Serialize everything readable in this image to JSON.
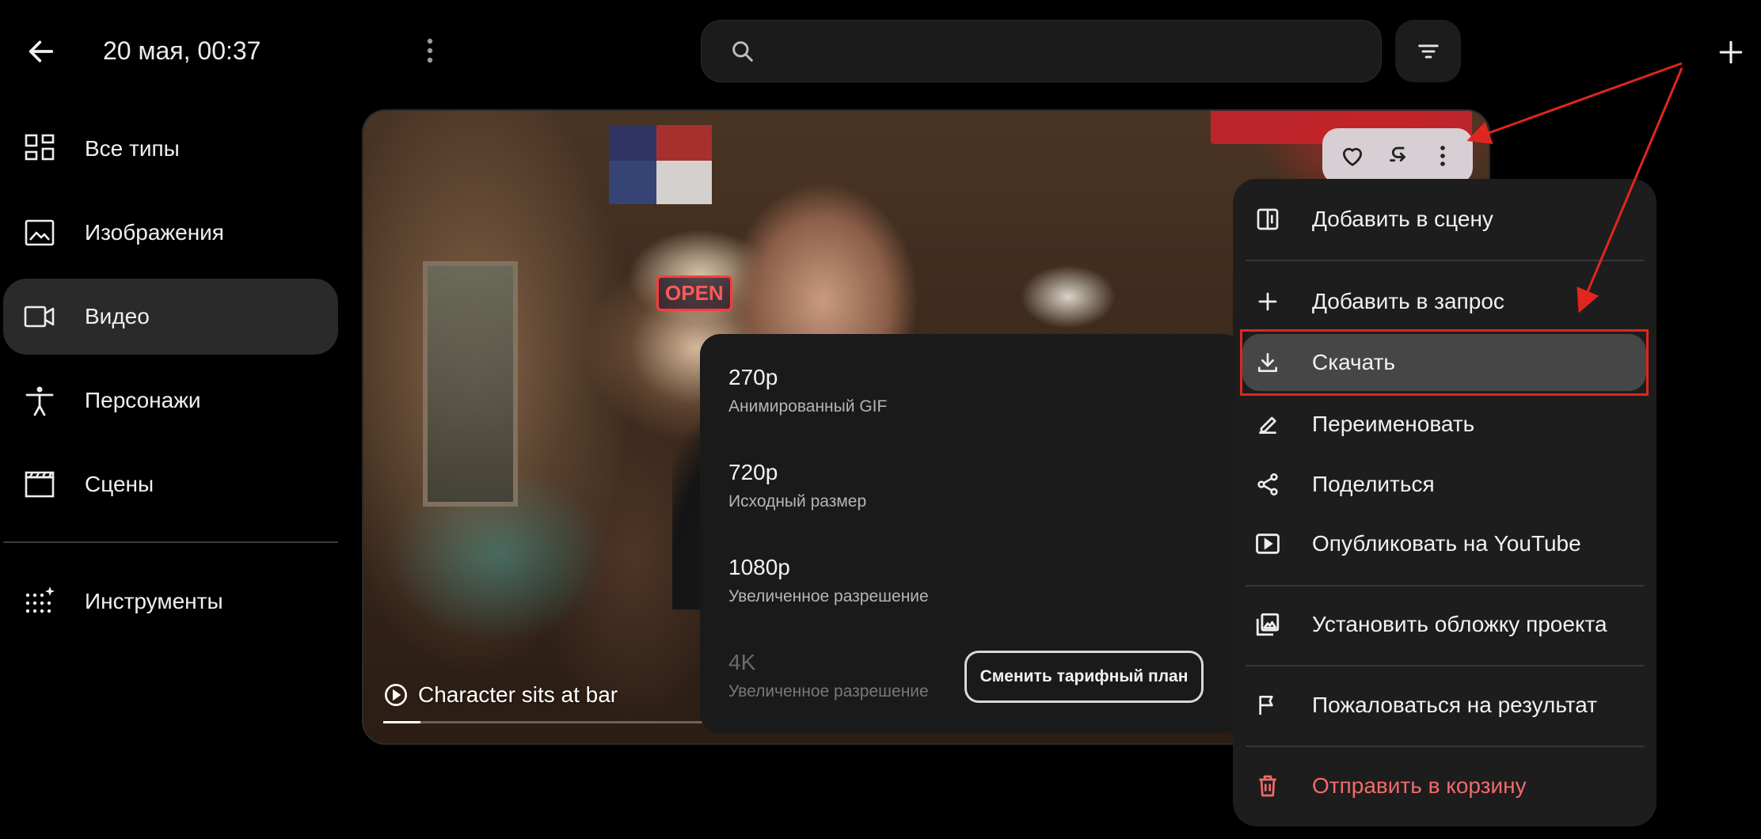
{
  "header": {
    "title": "20 мая, 00:37",
    "search_placeholder": ""
  },
  "sidebar": {
    "items": [
      {
        "label": "Все типы",
        "icon": "grid-icon"
      },
      {
        "label": "Изображения",
        "icon": "image-icon"
      },
      {
        "label": "Видео",
        "icon": "video-camera-icon",
        "active": true
      },
      {
        "label": "Персонажи",
        "icon": "person-icon"
      },
      {
        "label": "Сцены",
        "icon": "clapperboard-icon"
      },
      {
        "label": "Инструменты",
        "icon": "sparkle-dots-icon"
      }
    ]
  },
  "video": {
    "caption": "Character sits at bar",
    "progress": 0.115,
    "poster_sign": "OPEN"
  },
  "download_options": [
    {
      "resolution": "270p",
      "description": "Анимированный GIF",
      "enabled": true
    },
    {
      "resolution": "720p",
      "description": "Исходный размер",
      "enabled": true
    },
    {
      "resolution": "1080p",
      "description": "Увеличенное разрешение",
      "enabled": true
    },
    {
      "resolution": "4K",
      "description": "Увеличенное разрешение",
      "enabled": false
    }
  ],
  "upgrade_button": "Сменить тарифный план",
  "context_menu": {
    "items": [
      {
        "label": "Добавить в сцену",
        "icon": "add-to-scene-icon"
      },
      {
        "label": "Добавить в запрос",
        "icon": "plus-icon"
      },
      {
        "label": "Скачать",
        "icon": "download-icon",
        "highlighted": true
      },
      {
        "label": "Переименовать",
        "icon": "pencil-icon"
      },
      {
        "label": "Поделиться",
        "icon": "share-icon"
      },
      {
        "label": "Опубликовать на YouTube",
        "icon": "youtube-play-icon"
      },
      {
        "label": "Установить обложку проекта",
        "icon": "cover-image-icon"
      },
      {
        "label": "Пожаловаться на результат",
        "icon": "flag-icon"
      },
      {
        "label": "Отправить в корзину",
        "icon": "trash-icon",
        "danger": true
      }
    ]
  },
  "colors": {
    "background": "#000000",
    "panel": "#1d1d1d",
    "danger": "#f26a6a",
    "annotation": "#e0261f"
  }
}
